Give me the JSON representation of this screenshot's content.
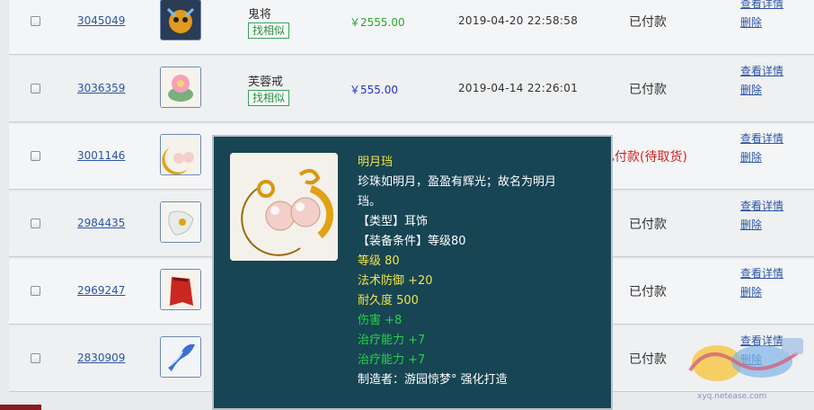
{
  "orders": [
    {
      "id": "3045049",
      "item": "鬼将",
      "similar": "找相似",
      "price": "￥2555.00",
      "price_color": "#2aa52e",
      "time": "2019-04-20 22:58:58",
      "status": "已付款",
      "status_red": false,
      "detail": "查看详情",
      "delete": "删除",
      "icon": "ghost-general-icon"
    },
    {
      "id": "3036359",
      "item": "芙蓉戒",
      "similar": "找相似",
      "price": "￥555.00",
      "price_color": "#2233cc",
      "time": "2019-04-14 22:26:01",
      "status": "已付款",
      "status_red": false,
      "detail": "查看详情",
      "delete": "删除",
      "icon": "lotus-ring-icon"
    },
    {
      "id": "3001146",
      "item": "",
      "similar": "",
      "price": "",
      "price_color": "#333333",
      "time": "",
      "status": "已付款(待取货)",
      "status_red": true,
      "detail": "查看详情",
      "delete": "删除",
      "icon": "moon-earring-icon"
    },
    {
      "id": "2984435",
      "item": "",
      "similar": "",
      "price": "",
      "price_color": "#333333",
      "time": "",
      "status": "已付款",
      "status_red": false,
      "detail": "查看详情",
      "delete": "删除",
      "icon": "white-charm-icon"
    },
    {
      "id": "2969247",
      "item": "",
      "similar": "",
      "price": "",
      "price_color": "#333333",
      "time": "",
      "status": "已付款",
      "status_red": false,
      "detail": "查看详情",
      "delete": "删除",
      "icon": "red-cape-icon"
    },
    {
      "id": "2830909",
      "item": "",
      "similar": "",
      "price": "",
      "price_color": "#333333",
      "time": "",
      "status": "已付款",
      "status_red": false,
      "detail": "查看详情",
      "delete": "删除",
      "icon": "blue-sash-icon"
    }
  ],
  "tooltip": {
    "name": "明月珰",
    "desc_line1": "珍珠如明月，盈盈有辉光；故名为明月",
    "desc_line2": "珰。",
    "type": "【类型】耳饰",
    "requirement": "【装备条件】等级80",
    "level": "等级 80",
    "magic_def": "法术防御 +20",
    "durability": "耐久度 500",
    "damage": "伤害 +8",
    "heal1": "治疗能力 +7",
    "heal2": "治疗能力 +7",
    "maker": "制造者：游园惊梦° 强化打造",
    "icon": "moon-earring-icon"
  },
  "watermark": {
    "logo_icon": "game-logo-icon",
    "url": "xyq.netease.com"
  }
}
